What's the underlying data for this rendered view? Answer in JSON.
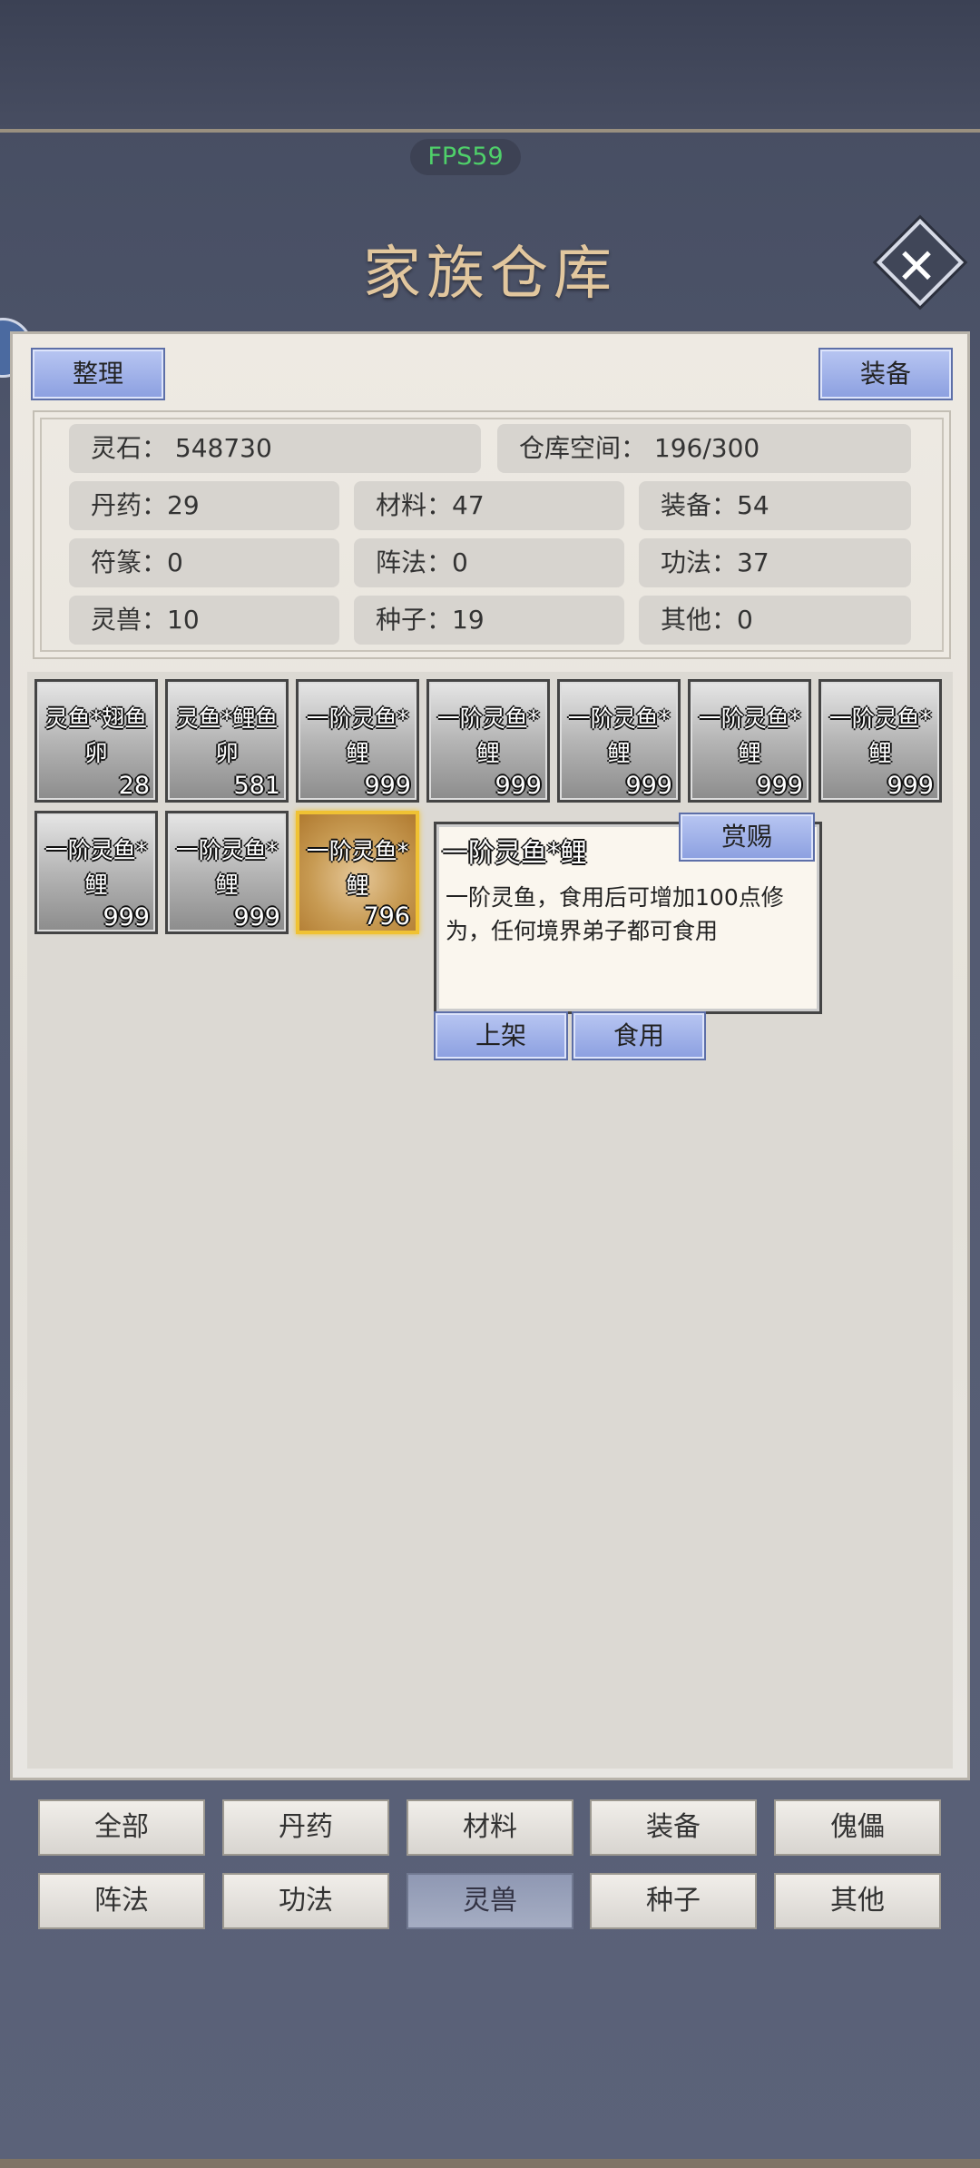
{
  "header": {
    "fps": "FPS59",
    "title": "家族仓库"
  },
  "toolbar": {
    "sort_label": "整理",
    "equip_label": "装备"
  },
  "stats": {
    "spirit_stone": "灵石：  548730",
    "storage": "仓库空间：    196/300",
    "pills": "丹药：29",
    "materials": "材料：47",
    "equipment": "装备：54",
    "talismans": "符篆：0",
    "formations": "阵法：0",
    "techniques": "功法：37",
    "beasts": "灵兽：10",
    "seeds": "种子：19",
    "others": "其他：0"
  },
  "items": [
    {
      "name": "灵鱼*翅鱼卵",
      "qty": "28"
    },
    {
      "name": "灵鱼*鲤鱼卵",
      "qty": "581"
    },
    {
      "name": "一阶灵鱼*鲤",
      "qty": "999"
    },
    {
      "name": "一阶灵鱼*鲤",
      "qty": "999"
    },
    {
      "name": "一阶灵鱼*鲤",
      "qty": "999"
    },
    {
      "name": "一阶灵鱼*鲤",
      "qty": "999"
    },
    {
      "name": "一阶灵鱼*鲤",
      "qty": "999"
    },
    {
      "name": "一阶灵鱼*鲤",
      "qty": "999"
    },
    {
      "name": "一阶灵鱼*鲤",
      "qty": "999"
    },
    {
      "name": "一阶灵鱼*鲤",
      "qty": "796"
    }
  ],
  "tooltip": {
    "title": "一阶灵鱼*鲤",
    "reward_label": "赏赐",
    "description": "一阶灵鱼，食用后可增加100点修为，任何境界弟子都可食用",
    "list_label": "上架",
    "eat_label": "食用"
  },
  "categories": [
    "全部",
    "丹药",
    "材料",
    "装备",
    "傀儡",
    "阵法",
    "功法",
    "灵兽",
    "种子",
    "其他"
  ],
  "active_category": "灵兽",
  "colors": {
    "fps_green": "#4fd06a",
    "title_gold": "#e2c79e",
    "selected_border": "#f0c233"
  }
}
